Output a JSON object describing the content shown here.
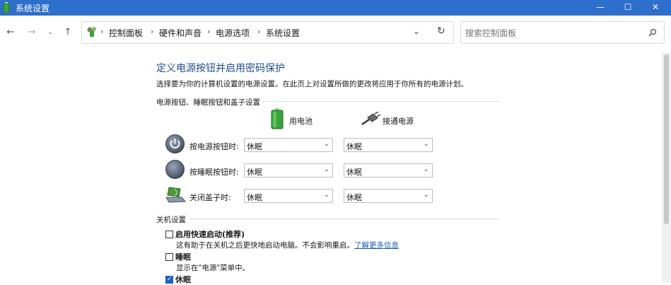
{
  "window": {
    "title": "系统设置",
    "minimize": "—",
    "maximize": "☐",
    "close": "✕"
  },
  "breadcrumb": [
    "控制面板",
    "硬件和声音",
    "电源选项",
    "系统设置"
  ],
  "search": {
    "placeholder": "搜索控制面板"
  },
  "page": {
    "heading": "定义电源按钮并启用密码保护",
    "description": "选择要为你的计算机设置的电源设置。在此页上对设置所做的更改将应用于你所有的电源计划。"
  },
  "buttons_section": {
    "title": "电源按钮、睡眠按钮和盖子设置",
    "battery_label": "用电池",
    "plugged_label": "接通电源",
    "rows": [
      {
        "label": "按电源按钮时:",
        "battery": "休眠",
        "plugged": "休眠",
        "icon": "power-button-icon"
      },
      {
        "label": "按睡眠按钮时:",
        "battery": "休眠",
        "plugged": "休眠",
        "icon": "sleep-button-icon"
      },
      {
        "label": "关闭盖子时:",
        "battery": "休眠",
        "plugged": "休眠",
        "icon": "laptop-lid-icon"
      }
    ]
  },
  "shutdown_section": {
    "title": "关机设置",
    "fast_startup": {
      "label": "启用快速启动(推荐)",
      "desc": "这有助于在关机之后更快地启动电脑。不会影响重启。",
      "link": "了解更多信息",
      "checked": false
    },
    "sleep": {
      "label": "睡眠",
      "desc": "显示在\"电源\"菜单中。",
      "checked": false
    },
    "hibernate": {
      "label": "休眠",
      "checked": true
    }
  },
  "colors": {
    "titlebar": "#2e6fcb",
    "heading": "#1e4e8c",
    "link": "#1a5fb4"
  }
}
